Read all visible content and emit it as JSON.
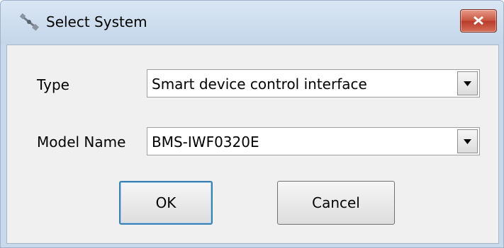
{
  "window": {
    "title": "Select System",
    "close_icon": "close-icon",
    "app_icon": "satellite-icon"
  },
  "form": {
    "type_label": "Type",
    "type_value": "Smart device control interface",
    "model_label": "Model Name",
    "model_value": "BMS-IWF0320E"
  },
  "buttons": {
    "ok_label": "OK",
    "cancel_label": "Cancel"
  },
  "colors": {
    "client_background": "#f0f0f0",
    "close_button": "#c5533f",
    "default_button_border": "#3c7fb1"
  }
}
